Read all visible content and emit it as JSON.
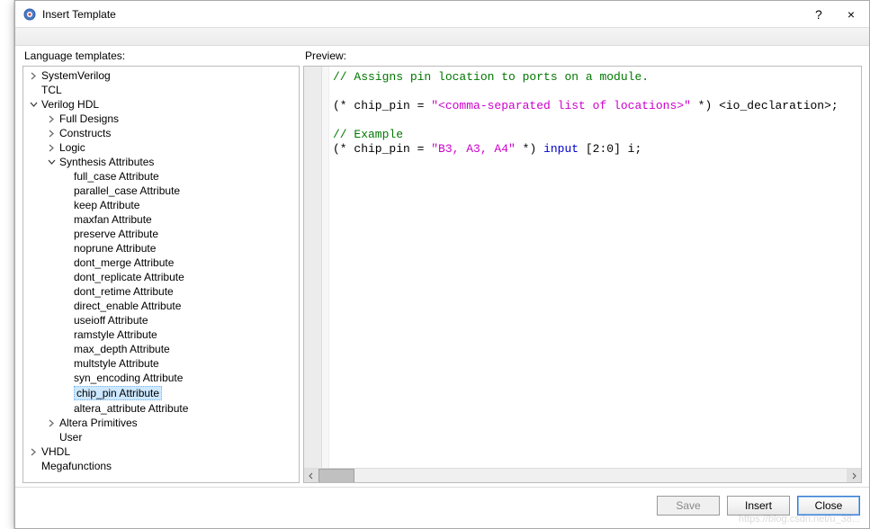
{
  "window": {
    "title": "Insert Template",
    "help_tooltip": "?",
    "close_tooltip": "×"
  },
  "left": {
    "label": "Language templates:",
    "tree": [
      {
        "label": "SystemVerilog",
        "level": 1,
        "chev": "right"
      },
      {
        "label": "TCL",
        "level": 1,
        "chev": "none"
      },
      {
        "label": "Verilog HDL",
        "level": 1,
        "chev": "down"
      },
      {
        "label": "Full Designs",
        "level": 2,
        "chev": "right"
      },
      {
        "label": "Constructs",
        "level": 2,
        "chev": "right"
      },
      {
        "label": "Logic",
        "level": 2,
        "chev": "right"
      },
      {
        "label": "Synthesis Attributes",
        "level": 2,
        "chev": "down"
      },
      {
        "label": "full_case Attribute",
        "level": 3,
        "chev": "none"
      },
      {
        "label": "parallel_case Attribute",
        "level": 3,
        "chev": "none"
      },
      {
        "label": "keep Attribute",
        "level": 3,
        "chev": "none"
      },
      {
        "label": "maxfan Attribute",
        "level": 3,
        "chev": "none"
      },
      {
        "label": "preserve Attribute",
        "level": 3,
        "chev": "none"
      },
      {
        "label": "noprune Attribute",
        "level": 3,
        "chev": "none"
      },
      {
        "label": "dont_merge Attribute",
        "level": 3,
        "chev": "none"
      },
      {
        "label": "dont_replicate Attribute",
        "level": 3,
        "chev": "none"
      },
      {
        "label": "dont_retime Attribute",
        "level": 3,
        "chev": "none"
      },
      {
        "label": "direct_enable Attribute",
        "level": 3,
        "chev": "none"
      },
      {
        "label": "useioff Attribute",
        "level": 3,
        "chev": "none"
      },
      {
        "label": "ramstyle Attribute",
        "level": 3,
        "chev": "none"
      },
      {
        "label": "max_depth Attribute",
        "level": 3,
        "chev": "none"
      },
      {
        "label": "multstyle Attribute",
        "level": 3,
        "chev": "none"
      },
      {
        "label": "syn_encoding Attribute",
        "level": 3,
        "chev": "none"
      },
      {
        "label": "chip_pin Attribute",
        "level": 3,
        "chev": "none",
        "selected": true
      },
      {
        "label": "altera_attribute Attribute",
        "level": 3,
        "chev": "none"
      },
      {
        "label": "Altera Primitives",
        "level": 2,
        "chev": "right"
      },
      {
        "label": "User",
        "level": 2,
        "chev": "none"
      },
      {
        "label": "VHDL",
        "level": 1,
        "chev": "right"
      },
      {
        "label": "Megafunctions",
        "level": 1,
        "chev": "none"
      }
    ]
  },
  "right": {
    "label": "Preview:",
    "code": {
      "line1_comment": "// Assigns pin location to ports on a module.",
      "line2_pre": "(* chip_pin = ",
      "line2_str": "\"<comma-separated list of locations>\"",
      "line2_post": " *) <io_declaration>;",
      "line3_comment": "// Example",
      "line4_pre": "(* chip_pin = ",
      "line4_str": "\"B3, A3, A4\"",
      "line4_mid": " *) ",
      "line4_kw": "input",
      "line4_post": " [2:0] i;"
    }
  },
  "footer": {
    "save": "Save",
    "insert": "Insert",
    "close": "Close"
  },
  "watermark": "https://blog.csdn.net/u_38..."
}
